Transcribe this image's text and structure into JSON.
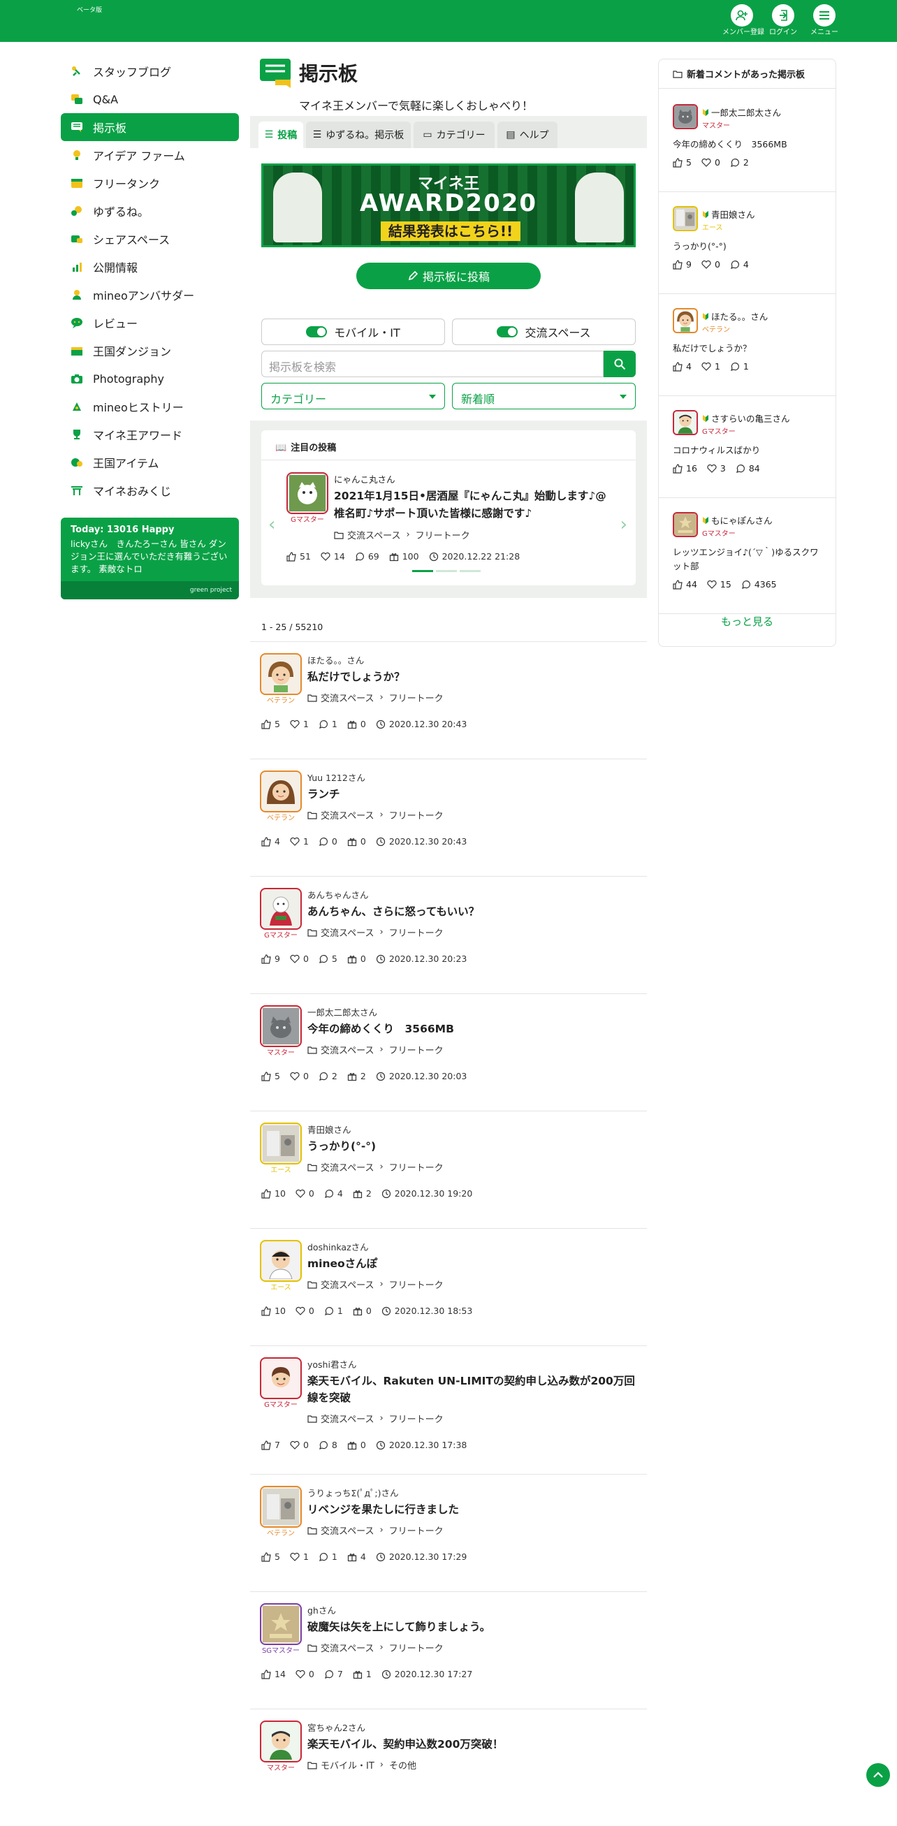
{
  "header": {
    "logo_text": "マイネ王",
    "logo_sub": "ベータ版",
    "buttons": [
      {
        "label": "メンバー登録",
        "icon": "add-user-icon"
      },
      {
        "label": "ログイン",
        "icon": "login-icon"
      },
      {
        "label": "メニュー",
        "icon": "menu-icon"
      }
    ],
    "brand_color": "#0aa146"
  },
  "sidebar": {
    "items": [
      {
        "label": "スタッフブログ",
        "icon": "staff-blog-icon"
      },
      {
        "label": "Q&A",
        "icon": "qa-icon"
      },
      {
        "label": "掲示板",
        "icon": "board-icon",
        "active": true
      },
      {
        "label": "アイデア ファーム",
        "icon": "idea-farm-icon"
      },
      {
        "label": "フリータンク",
        "icon": "free-tank-icon"
      },
      {
        "label": "ゆずるね。",
        "icon": "yuzurune-icon"
      },
      {
        "label": "シェアスペース",
        "icon": "share-space-icon"
      },
      {
        "label": "公開情報",
        "icon": "public-info-icon"
      },
      {
        "label": "mineoアンバサダー",
        "icon": "ambassador-icon"
      },
      {
        "label": "レビュー",
        "icon": "review-icon"
      },
      {
        "label": "王国ダンジョン",
        "icon": "dungeon-icon"
      },
      {
        "label": "Photography",
        "icon": "camera-icon"
      },
      {
        "label": "mineoヒストリー",
        "icon": "history-icon"
      },
      {
        "label": "マイネ王アワード",
        "icon": "trophy-icon"
      },
      {
        "label": "王国アイテム",
        "icon": "item-icon"
      },
      {
        "label": "マイネおみくじ",
        "icon": "omikuji-icon"
      }
    ],
    "happy": {
      "title": "Today: 13016 Happy",
      "body": "lickyさん　きんたろーさん 皆さん ダンジョン王に選んでいただき有難うございます。 素敵なトロ",
      "footer": "green project"
    }
  },
  "main": {
    "title": "掲示板",
    "subtitle": "マイネ王メンバーで気軽に楽しくおしゃべり！",
    "tabs": [
      {
        "label": "投稿",
        "active": true
      },
      {
        "label": "ゆずるね。掲示板"
      },
      {
        "label": "カテゴリー"
      },
      {
        "label": "ヘルプ"
      }
    ],
    "banner": {
      "line1": "マイネ王",
      "line2": "AWARD2020",
      "line3": "結果発表はこちら!!"
    },
    "post_button": "掲示板に投稿",
    "toggles": [
      {
        "label": "モバイル・IT",
        "on": true
      },
      {
        "label": "交流スペース",
        "on": true
      }
    ],
    "search_placeholder": "掲示板を検索",
    "category_select": "カテゴリー",
    "sort_select": "新着順",
    "featured": {
      "heading": "注目の投稿",
      "user": "にゃんこ丸さん",
      "rank": "Gマスター",
      "title": "2021年1月15日•居酒屋『にゃんこ丸』始動します♪@椎名町♪サポート頂いた皆様に感謝です♪",
      "category": "交流スペース",
      "subcategory": "フリートーク",
      "likes": "51",
      "hearts": "14",
      "comments": "69",
      "gifts": "100",
      "date": "2020.12.22 21:28",
      "slides": 3,
      "active_slide": 0
    },
    "count_text": "1 - 25 / 55210",
    "posts": [
      {
        "user": "ほたる。。さん",
        "rank": "ベテラン",
        "rank_color": "#e58a2c",
        "title": "私だけでしょうか？",
        "category": "交流スペース",
        "subcategory": "フリートーク",
        "likes": "5",
        "hearts": "1",
        "comments": "1",
        "gifts": "0",
        "date": "2020.12.30 20:43",
        "avatar": "girl-avatar"
      },
      {
        "user": "Yuu 1212さん",
        "rank": "ベテラン",
        "rank_color": "#e58a2c",
        "title": "ランチ",
        "category": "交流スペース",
        "subcategory": "フリートーク",
        "likes": "4",
        "hearts": "1",
        "comments": "0",
        "gifts": "0",
        "date": "2020.12.30 20:43",
        "avatar": "woman-avatar"
      },
      {
        "user": "あんちゃんさん",
        "rank": "Gマスター",
        "rank_color": "#c8283a",
        "title": "あんちゃん、さらに怒ってもいい？",
        "category": "交流スペース",
        "subcategory": "フリートーク",
        "likes": "9",
        "hearts": "0",
        "comments": "5",
        "gifts": "0",
        "date": "2020.12.30 20:23",
        "avatar": "doll-avatar"
      },
      {
        "user": "一郎太二郎太さん",
        "rank": "マスター",
        "rank_color": "#c8283a",
        "title": "今年の締めくくり　3566MB",
        "category": "交流スペース",
        "subcategory": "フリートーク",
        "likes": "5",
        "hearts": "0",
        "comments": "2",
        "gifts": "2",
        "date": "2020.12.30 20:03",
        "avatar": "cat-avatar"
      },
      {
        "user": "青田娘さん",
        "rank": "エース",
        "rank_color": "#e2c200",
        "title": "うっかり(°-°)",
        "category": "交流スペース",
        "subcategory": "フリートーク",
        "likes": "10",
        "hearts": "0",
        "comments": "4",
        "gifts": "2",
        "date": "2020.12.30 19:20",
        "avatar": "photo-avatar"
      },
      {
        "user": "doshinkazさん",
        "rank": "エース",
        "rank_color": "#e2c200",
        "title": "mineoさんぽ",
        "category": "交流スペース",
        "subcategory": "フリートーク",
        "likes": "10",
        "hearts": "0",
        "comments": "1",
        "gifts": "0",
        "date": "2020.12.30 18:53",
        "avatar": "man-avatar"
      },
      {
        "user": "yoshi君さん",
        "rank": "Gマスター",
        "rank_color": "#c8283a",
        "title": "楽天モバイル、Rakuten UN-LIMITの契約申し込み数が200万回線を突破",
        "category": "交流スペース",
        "subcategory": "フリートーク",
        "likes": "7",
        "hearts": "0",
        "comments": "8",
        "gifts": "0",
        "date": "2020.12.30 17:38",
        "avatar": "boy-avatar"
      },
      {
        "user": "うりょっちΣ(ﾟдﾟ;)さん",
        "rank": "ベテラン",
        "rank_color": "#e58a2c",
        "title": "リベンジを果たしに行きました",
        "category": "交流スペース",
        "subcategory": "フリートーク",
        "likes": "5",
        "hearts": "1",
        "comments": "1",
        "gifts": "4",
        "date": "2020.12.30 17:29",
        "avatar": "photo-avatar"
      },
      {
        "user": "ghさん",
        "rank": "SGマスター",
        "rank_color": "#7b3fa8",
        "title": "破魔矢は矢を上にして飾りましょう。",
        "category": "交流スペース",
        "subcategory": "フリートーク",
        "likes": "14",
        "hearts": "0",
        "comments": "7",
        "gifts": "1",
        "date": "2020.12.30 17:27",
        "avatar": "emblem-avatar"
      },
      {
        "user": "宮ちゃん2さん",
        "rank": "マスター",
        "rank_color": "#c8283a",
        "title": "楽天モバイル、契約申込数200万突破！",
        "category": "モバイル・IT",
        "subcategory": "その他",
        "likes": "",
        "hearts": "",
        "comments": "",
        "gifts": "",
        "date": "",
        "avatar": "man2-avatar"
      }
    ]
  },
  "right": {
    "heading": "新着コメントがあった掲示板",
    "items": [
      {
        "user": "一郎太二郎太さん",
        "rank": "マスター",
        "rank_color": "#c8283a",
        "body": "今年の締めくくり　3566MB",
        "likes": "5",
        "hearts": "0",
        "comments": "2"
      },
      {
        "user": "青田娘さん",
        "rank": "エース",
        "rank_color": "#e2c200",
        "body": "うっかり(°-°)",
        "likes": "9",
        "hearts": "0",
        "comments": "4"
      },
      {
        "user": "ほたる。。さん",
        "rank": "ベテラン",
        "rank_color": "#e58a2c",
        "body": "私だけでしょうか？",
        "likes": "4",
        "hearts": "1",
        "comments": "1"
      },
      {
        "user": "さすらいの亀三さん",
        "rank": "Gマスター",
        "rank_color": "#c8283a",
        "body": "コロナウィルスばかり",
        "likes": "16",
        "hearts": "3",
        "comments": "84"
      },
      {
        "user": "もにゃぽんさん",
        "rank": "Gマスター",
        "rank_color": "#c8283a",
        "body": "レッツエンジョイ♪(´▽｀)ゆるスクワット部",
        "likes": "44",
        "hearts": "15",
        "comments": "4365"
      }
    ],
    "more": "もっと見る"
  }
}
